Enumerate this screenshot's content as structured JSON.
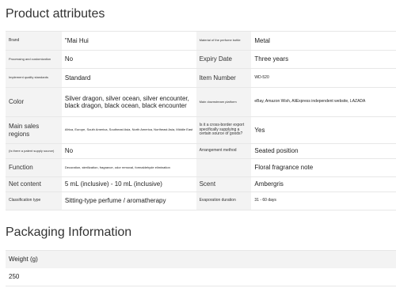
{
  "sections": {
    "product_attributes": "Product attributes",
    "packaging_information": "Packaging Information"
  },
  "attributes": {
    "brand_label": "Brand",
    "brand_value": "\"Mai Hui",
    "material_label": "Material of the perfume bottle",
    "material_value": "Metal",
    "processing_label": "Processing and customization",
    "processing_value": "No",
    "expiry_label": "Expiry Date",
    "expiry_value": "Three years",
    "quality_label": "Implement quality standards",
    "quality_value": "Standard",
    "item_number_label": "Item Number",
    "item_number_value": "WD-520",
    "color_label": "Color",
    "color_value": "Silver dragon, silver ocean, silver encounter, black dragon, black ocean, black encounter",
    "platform_label": "Main downstream platform",
    "platform_value": "eBay, Amazon Wish, AliExpress independent website, LAZADA",
    "regions_label": "Main sales regions",
    "regions_value": "Africa, Europe, South America, Southeast Asia, North America, Northeast Asia, Middle East",
    "cross_border_label": "Is it a cross-border export specifically supplying a certain source of goods?",
    "cross_border_value": "Yes",
    "patent_label": "(Is there a patent supply source)",
    "patent_value": "No",
    "arrangement_label": "Arrangement method",
    "arrangement_value": "Seated position",
    "function_label": "Function",
    "function_value": "Decoration, sterilization, fragrance, odor removal, formaldehyde elimination",
    "fragrance_value": "Floral fragrance note",
    "net_content_label": "Net content",
    "net_content_value": "5 mL (inclusive) - 10 mL (inclusive)",
    "scent_label": "Scent",
    "scent_value": "Ambergris",
    "classification_label": "Classification type",
    "classification_value": "Sitting-type perfume / aromatherapy",
    "evaporation_label": "Evaporation duration",
    "evaporation_value": "31 - 60 days"
  },
  "packaging": {
    "weight_label": "Weight (g)",
    "weight_value": "250"
  }
}
